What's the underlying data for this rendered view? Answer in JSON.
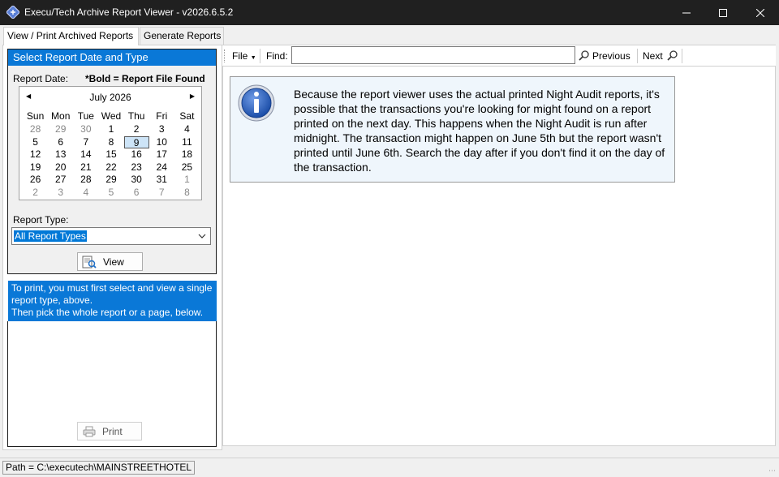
{
  "window": {
    "title": "Execu/Tech Archive Report Viewer - v2026.6.5.2"
  },
  "tabs": [
    {
      "label": "View / Print Archived Reports",
      "active": true
    },
    {
      "label": "Generate Reports",
      "active": false
    }
  ],
  "left_panel": {
    "header": "Select Report Date and Type",
    "report_date_label": "Report Date:",
    "bold_note": "*Bold = Report File Found",
    "calendar": {
      "month_label": "July 2026",
      "days_of_week": [
        "Sun",
        "Mon",
        "Tue",
        "Wed",
        "Thu",
        "Fri",
        "Sat"
      ],
      "selected_day": "9",
      "weeks": [
        [
          "28",
          "29",
          "30",
          "1",
          "2",
          "3",
          "4"
        ],
        [
          "5",
          "6",
          "7",
          "8",
          "9",
          "10",
          "11"
        ],
        [
          "12",
          "13",
          "14",
          "15",
          "16",
          "17",
          "18"
        ],
        [
          "19",
          "20",
          "21",
          "22",
          "23",
          "24",
          "25"
        ],
        [
          "26",
          "27",
          "28",
          "29",
          "30",
          "31",
          "1"
        ],
        [
          "2",
          "3",
          "4",
          "5",
          "6",
          "7",
          "8"
        ]
      ]
    },
    "report_type_label": "Report Type:",
    "report_type_value": "All Report Types",
    "view_button": "View",
    "print_info": "To print, you must first select and view a single report type, above.\nThen pick the whole report or a page, below.",
    "print_button": "Print"
  },
  "toolbar": {
    "file_menu": "File",
    "find_label": "Find:",
    "find_value": "",
    "previous": "Previous",
    "next": "Next"
  },
  "notice": {
    "message": "Because the report viewer uses the actual printed Night Audit reports, it's possible that the transactions you're looking for might found on a report printed on the next day. This happens when the Night Audit is run after midnight. The transaction might happen on June 5th but the report wasn't printed until June 6th. Search the day after if you don't find it on the day of the transaction."
  },
  "status": {
    "path": "Path = C:\\executech\\MAINSTREETHOTEL"
  },
  "colors": {
    "accent_blue": "#0a78d7",
    "title_bar": "#202020",
    "notice_bg": "#eff6fc"
  }
}
